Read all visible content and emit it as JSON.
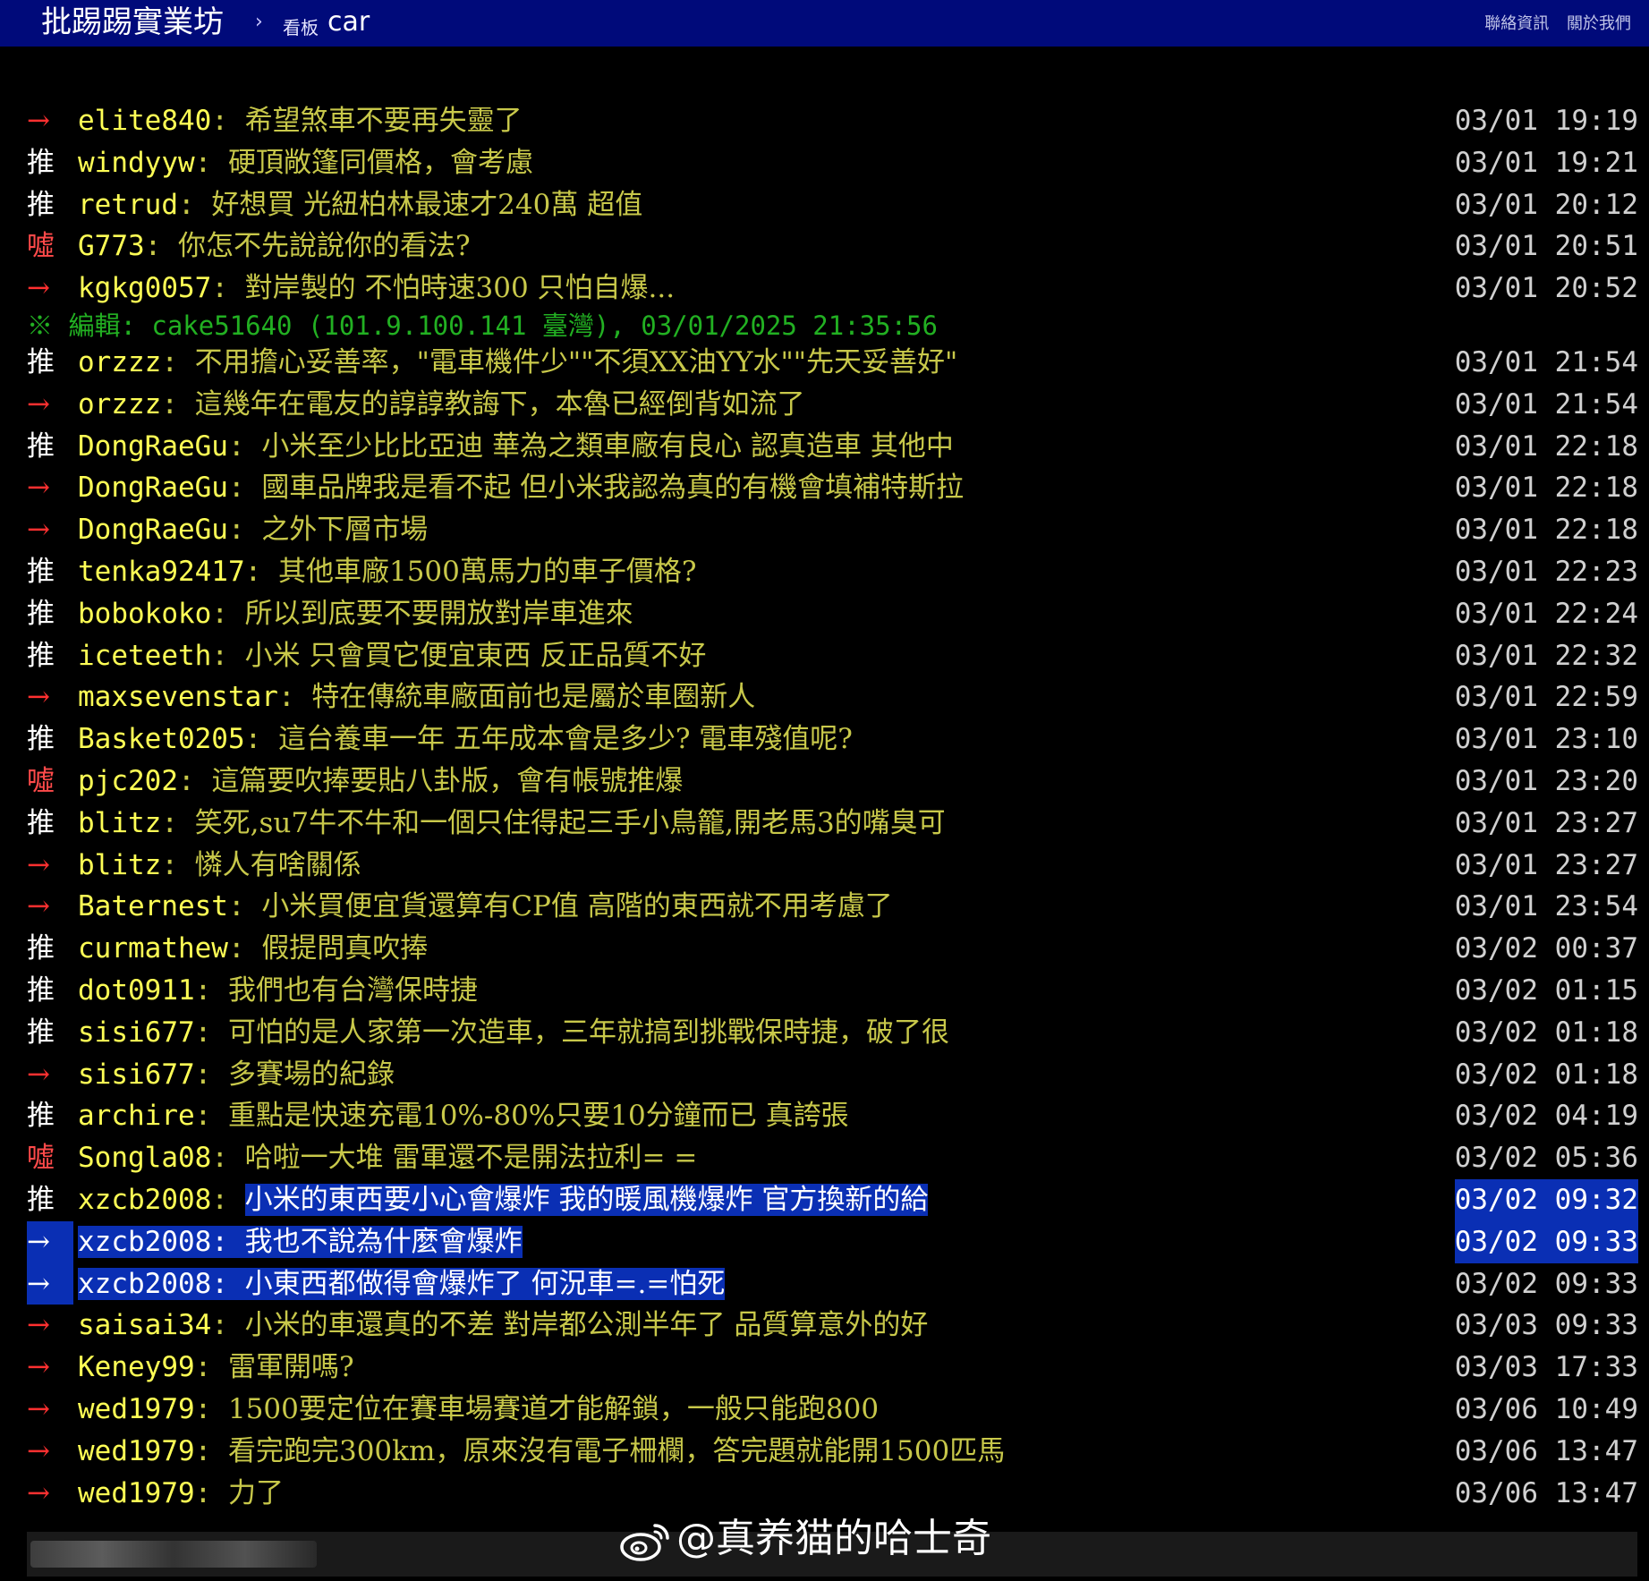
{
  "header": {
    "site_title": "批踢踢實業坊",
    "separator": "›",
    "board_label": "看板",
    "board_name": "car",
    "links": [
      "聯絡資訊",
      "關於我們"
    ]
  },
  "colors": {
    "header_bg": "#000a7a",
    "userid": "#ffff55",
    "message": "#c8c84a",
    "push_tag": "#ffffff",
    "boo_tag": "#ff4a4a",
    "arrow_tag": "#ff3030",
    "highlight": "#0a2fb4",
    "edit_line": "#22b022"
  },
  "comments": [
    {
      "tag": "→",
      "user": "elite840",
      "msg": "希望煞車不要再失靈了",
      "time": "03/01 19:19"
    },
    {
      "tag": "推",
      "user": "windyyw",
      "msg": "硬頂敞篷同價格，會考慮",
      "time": "03/01 19:21"
    },
    {
      "tag": "推",
      "user": "retrud",
      "msg": "好想買 光紐柏林最速才240萬 超值",
      "time": "03/01 20:12"
    },
    {
      "tag": "噓",
      "user": "G773",
      "msg": "你怎不先說說你的看法?",
      "time": "03/01 20:51"
    },
    {
      "tag": "→",
      "user": "kgkg0057",
      "msg": "對岸製的 不怕時速300 只怕自爆...",
      "time": "03/01 20:52"
    },
    {
      "edit": "※ 編輯: cake51640 (101.9.100.141 臺灣), 03/01/2025 21:35:56"
    },
    {
      "tag": "推",
      "user": "orzzz",
      "msg": "不用擔心妥善率，\"電車機件少\"\"不須XX油YY水\"\"先天妥善好\"",
      "time": "03/01 21:54"
    },
    {
      "tag": "→",
      "user": "orzzz",
      "msg": "這幾年在電友的諄諄教誨下，本魯已經倒背如流了",
      "time": "03/01 21:54"
    },
    {
      "tag": "推",
      "user": "DongRaeGu",
      "msg": "小米至少比比亞迪 華為之類車廠有良心 認真造車 其他中",
      "time": "03/01 22:18"
    },
    {
      "tag": "→",
      "user": "DongRaeGu",
      "msg": "國車品牌我是看不起 但小米我認為真的有機會填補特斯拉",
      "time": "03/01 22:18"
    },
    {
      "tag": "→",
      "user": "DongRaeGu",
      "msg": "之外下層市場",
      "time": "03/01 22:18"
    },
    {
      "tag": "推",
      "user": "tenka92417",
      "msg": "其他車廠1500萬馬力的車子價格?",
      "time": "03/01 22:23"
    },
    {
      "tag": "推",
      "user": "bobokoko",
      "msg": "所以到底要不要開放對岸車進來",
      "time": "03/01 22:24"
    },
    {
      "tag": "推",
      "user": "iceteeth",
      "msg": "小米 只會買它便宜東西 反正品質不好",
      "time": "03/01 22:32"
    },
    {
      "tag": "→",
      "user": "maxsevenstar",
      "msg": "特在傳統車廠面前也是屬於車圈新人",
      "time": "03/01 22:59"
    },
    {
      "tag": "推",
      "user": "Basket0205",
      "msg": "這台養車一年 五年成本會是多少? 電車殘值呢?",
      "time": "03/01 23:10"
    },
    {
      "tag": "噓",
      "user": "pjc202",
      "msg": "這篇要吹捧要貼八卦版，會有帳號推爆",
      "time": "03/01 23:20"
    },
    {
      "tag": "推",
      "user": "blitz",
      "msg": "笑死,su7牛不牛和一個只住得起三手小鳥籠,開老馬3的嘴臭可",
      "time": "03/01 23:27"
    },
    {
      "tag": "→",
      "user": "blitz",
      "msg": "憐人有啥關係",
      "time": "03/01 23:27"
    },
    {
      "tag": "→",
      "user": "Baternest",
      "msg": "小米買便宜貨還算有CP值 高階的東西就不用考慮了",
      "time": "03/01 23:54"
    },
    {
      "tag": "推",
      "user": "curmathew",
      "msg": "假提問真吹捧",
      "time": "03/02 00:37"
    },
    {
      "tag": "推",
      "user": "dot0911",
      "msg": "我們也有台灣保時捷",
      "time": "03/02 01:15"
    },
    {
      "tag": "推",
      "user": "sisi677",
      "msg": "可怕的是人家第一次造車，三年就搞到挑戰保時捷，破了很",
      "time": "03/02 01:18"
    },
    {
      "tag": "→",
      "user": "sisi677",
      "msg": "多賽場的紀錄",
      "time": "03/02 01:18"
    },
    {
      "tag": "推",
      "user": "archire",
      "msg": "重點是快速充電10%-80%只要10分鐘而已 真誇張",
      "time": "03/02 04:19"
    },
    {
      "tag": "噓",
      "user": "Songla08",
      "msg": "哈啦一大堆 雷軍還不是開法拉利= =",
      "time": "03/02 05:36"
    },
    {
      "tag": "推",
      "user": "xzcb2008",
      "msg": "小米的東西要小心會爆炸 我的暖風機爆炸 官方換新的給",
      "time": "03/02 09:32",
      "hl": "msg"
    },
    {
      "tag": "→",
      "user": "xzcb2008",
      "msg": "我也不說為什麼會爆炸",
      "time": "03/02 09:33",
      "hl": "full"
    },
    {
      "tag": "→",
      "user": "xzcb2008",
      "msg": "小東西都做得會爆炸了 何況車=.=怕死",
      "time": "03/02 09:33",
      "hl": "notime"
    },
    {
      "tag": "→",
      "user": "saisai34",
      "msg": "小米的車還真的不差 對岸都公測半年了 品質算意外的好",
      "time": "03/03 09:33"
    },
    {
      "tag": "→",
      "user": "Keney99",
      "msg": "雷軍開嗎?",
      "time": "03/03 17:33"
    },
    {
      "tag": "→",
      "user": "wed1979",
      "msg": "1500要定位在賽車場賽道才能解鎖，一般只能跑800",
      "time": "03/06 10:49"
    },
    {
      "tag": "→",
      "user": "wed1979",
      "msg": "看完跑完300km，原來沒有電子柵欄，答完題就能開1500匹馬",
      "time": "03/06 13:47"
    },
    {
      "tag": "→",
      "user": "wed1979",
      "msg": "力了",
      "time": "03/06 13:47"
    }
  ],
  "watermark": {
    "icon": "weibo-icon",
    "text": "@真养猫的哈士奇"
  }
}
